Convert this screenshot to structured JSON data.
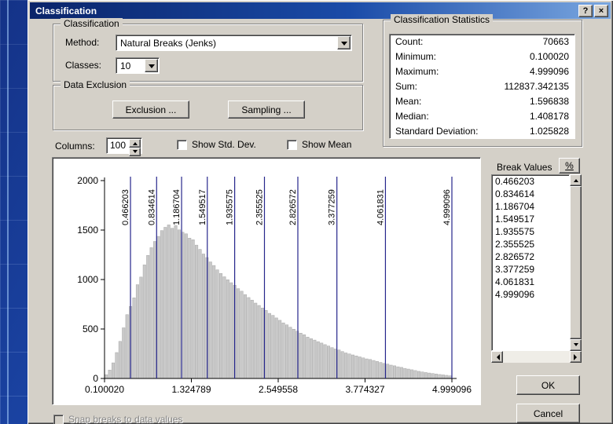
{
  "window": {
    "title": "Classification",
    "help_glyph": "?",
    "close_glyph": "×"
  },
  "classification": {
    "group_label": "Classification",
    "method_label": "Method:",
    "method_value": "Natural Breaks (Jenks)",
    "classes_label": "Classes:",
    "classes_value": "10"
  },
  "data_exclusion": {
    "group_label": "Data Exclusion",
    "exclusion_button": "Exclusion ...",
    "sampling_button": "Sampling ..."
  },
  "columns": {
    "label": "Columns:",
    "value": "100",
    "show_std_dev_label": "Show Std. Dev.",
    "show_mean_label": "Show Mean"
  },
  "statistics": {
    "group_label": "Classification Statistics",
    "rows": [
      {
        "label": "Count:",
        "value": "70663"
      },
      {
        "label": "Minimum:",
        "value": "0.100020"
      },
      {
        "label": "Maximum:",
        "value": "4.999096"
      },
      {
        "label": "Sum:",
        "value": "112837.342135"
      },
      {
        "label": "Mean:",
        "value": "1.596838"
      },
      {
        "label": "Median:",
        "value": "1.408178"
      },
      {
        "label": "Standard Deviation:",
        "value": "1.025828"
      }
    ]
  },
  "break_values": {
    "header": "Break Values",
    "percent_button": "%",
    "values": [
      "0.466203",
      "0.834614",
      "1.186704",
      "1.549517",
      "1.935575",
      "2.355525",
      "2.826572",
      "3.377259",
      "4.061831",
      "4.999096"
    ]
  },
  "actions": {
    "ok_label": "OK",
    "cancel_label": "Cancel"
  },
  "footer": {
    "snap_label": "Snap breaks to data values"
  },
  "chart_data": {
    "type": "bar",
    "title": "",
    "xlabel": "",
    "ylabel": "",
    "grid": false,
    "legend": false,
    "x_min": 0.10002,
    "x_max": 4.999096,
    "y_max": 2000,
    "y_ticks": [
      0,
      500,
      1000,
      1500,
      2000
    ],
    "x_tick_values": [
      0.10002,
      1.324789,
      2.549558,
      3.774327,
      4.999096
    ],
    "x_tick_labels": [
      "0.100020",
      "1.324789",
      "2.549558",
      "3.774327",
      "4.999096"
    ],
    "bin_count": 100,
    "bar_color": "#c9c9c9",
    "bar_edge_color": "#a8a8a8",
    "break_line_color": "#26268c",
    "break_lines": [
      0.466203,
      0.834614,
      1.186704,
      1.549517,
      1.935575,
      2.355525,
      2.826572,
      3.377259,
      4.061831,
      4.999096
    ],
    "break_line_labels": [
      "0.466203",
      "0.834614",
      "1.186704",
      "1.549517",
      "1.935575",
      "2.355525",
      "2.826572",
      "3.377259",
      "4.061831",
      "4.999096"
    ],
    "bar_values": [
      38,
      85,
      158,
      262,
      375,
      512,
      645,
      728,
      815,
      948,
      1025,
      1148,
      1244,
      1322,
      1385,
      1436,
      1495,
      1528,
      1552,
      1518,
      1545,
      1502,
      1478,
      1462,
      1418,
      1402,
      1348,
      1305,
      1258,
      1222,
      1178,
      1142,
      1098,
      1062,
      1028,
      998,
      968,
      942,
      908,
      882,
      848,
      818,
      792,
      762,
      738,
      712,
      688,
      658,
      638,
      612,
      588,
      562,
      542,
      518,
      498,
      478,
      458,
      442,
      418,
      402,
      388,
      372,
      358,
      342,
      328,
      312,
      298,
      288,
      272,
      258,
      248,
      238,
      228,
      218,
      208,
      198,
      192,
      182,
      172,
      162,
      152,
      145,
      135,
      128,
      118,
      112,
      102,
      95,
      88,
      80,
      72,
      66,
      60,
      55,
      50,
      45,
      40,
      36,
      32,
      27
    ]
  }
}
